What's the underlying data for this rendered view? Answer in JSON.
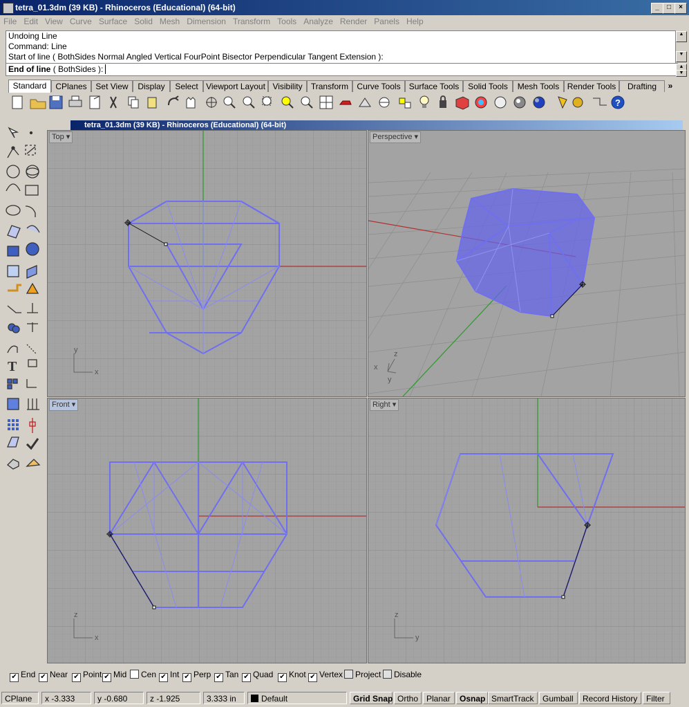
{
  "window": {
    "title": "tetra_01.3dm (39 KB) - Rhinoceros (Educational) (64-bit)"
  },
  "menu": [
    "File",
    "Edit",
    "View",
    "Curve",
    "Surface",
    "Solid",
    "Mesh",
    "Dimension",
    "Transform",
    "Tools",
    "Analyze",
    "Render",
    "Panels",
    "Help"
  ],
  "command": {
    "history": [
      "Undoing Line",
      "Command: Line",
      "Start of line ( BothSides  Normal  Angled  Vertical  FourPoint  Bisector  Perpendicular  Tangent  Extension ):"
    ],
    "prompt": "End of line",
    "prompt_options": "( BothSides ):"
  },
  "tabs": [
    "Standard",
    "CPlanes",
    "Set View",
    "Display",
    "Select",
    "Viewport Layout",
    "Visibility",
    "Transform",
    "Curve Tools",
    "Surface Tools",
    "Solid Tools",
    "Mesh Tools",
    "Render Tools",
    "Drafting"
  ],
  "tabs_more": "»",
  "subwindow_title": "tetra_01.3dm (39 KB) - Rhinoceros (Educational) (64-bit)",
  "viewports": {
    "top": {
      "label": "Top",
      "axis1": "y",
      "axis2": "x"
    },
    "perspective": {
      "label": "Perspective",
      "axis1": "z",
      "axis2": "x",
      "axis3": "y"
    },
    "front": {
      "label": "Front",
      "axis1": "z",
      "axis2": "x"
    },
    "right": {
      "label": "Right",
      "axis1": "z",
      "axis2": "y"
    }
  },
  "osnap": [
    {
      "label": "End",
      "checked": true
    },
    {
      "label": "Near",
      "checked": true
    },
    {
      "label": "Point",
      "checked": true
    },
    {
      "label": "Mid",
      "checked": true
    },
    {
      "label": "Cen",
      "checked": false
    },
    {
      "label": "Int",
      "checked": true
    },
    {
      "label": "Perp",
      "checked": true
    },
    {
      "label": "Tan",
      "checked": true
    },
    {
      "label": "Quad",
      "checked": true
    },
    {
      "label": "Knot",
      "checked": true
    },
    {
      "label": "Vertex",
      "checked": true
    },
    {
      "label": "Project",
      "checked": false
    },
    {
      "label": "Disable",
      "checked": false
    }
  ],
  "status": {
    "cplane": "CPlane",
    "x": "x -3.333",
    "y": "y -0.680",
    "z": "z -1.925",
    "distance": "3.333 in",
    "layer": "Default",
    "grid_snap": "Grid Snap",
    "ortho": "Ortho",
    "planar": "Planar",
    "osnap": "Osnap",
    "smarttrack": "SmartTrack",
    "gumball": "Gumball",
    "record_history": "Record History",
    "filter": "Filter"
  },
  "colors": {
    "object": "#6f6ff0",
    "xaxis": "#b03030",
    "yaxis": "#2a9a2a",
    "viewport_bg": "#a3a3a3"
  }
}
